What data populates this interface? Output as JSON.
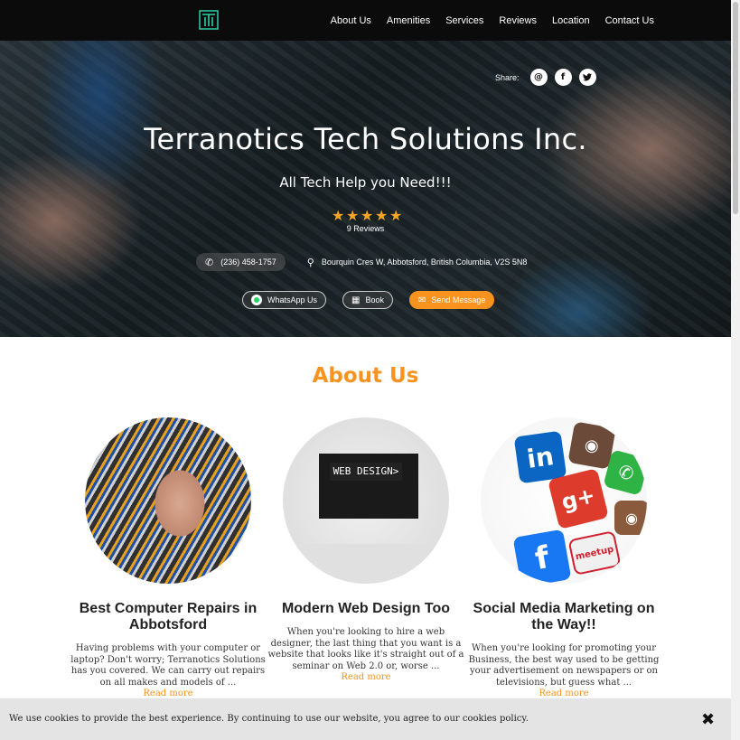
{
  "nav": {
    "items": [
      {
        "label": "About Us"
      },
      {
        "label": "Amenities"
      },
      {
        "label": "Services"
      },
      {
        "label": "Reviews"
      },
      {
        "label": "Location"
      },
      {
        "label": "Contact Us"
      }
    ]
  },
  "colors": {
    "accent": "#f7931e",
    "nav_bg": "#0b0b0b",
    "logo": "#2fd0a8"
  },
  "hero": {
    "share_label": "Share:",
    "share_icons": [
      {
        "name": "email-icon",
        "glyph": "@"
      },
      {
        "name": "facebook-icon",
        "glyph": "f"
      },
      {
        "name": "twitter-icon",
        "glyph": "t"
      }
    ],
    "title": "Terranotics Tech Solutions Inc.",
    "subtitle": "All Tech Help you Need!!!",
    "rating": 5,
    "reviews_label": "9 Reviews",
    "phone": "(236) 458-1757",
    "address": "Bourquin Cres W, Abbotsford, British Columbia, V2S 5N8",
    "buttons": {
      "whatsapp": "WhatsApp Us",
      "book": "Book",
      "message": "Send Message"
    }
  },
  "about": {
    "title": "About Us",
    "cards": [
      {
        "heading": "Best Computer Repairs in Abbotsford",
        "text": "Having problems with your computer or laptop? Don't worry; Terranotics Solutions has you covered. We can carry out repairs on all makes and models of ...",
        "more": "Read more"
      },
      {
        "heading": "Modern Web Design Too",
        "image_text": "WEB DESIGN>",
        "text": "When you're looking to hire a web designer, the last thing that you want is a website that looks like it's straight out of a seminar on Web 2.0 or, worse ...",
        "more": "Read more"
      },
      {
        "heading": "Social Media Marketing on the Way!!",
        "text": "When you're looking for promoting your Business, the best way used to be getting your advertisement on newspapers or on televisions, but guess what ...",
        "more": "Read more"
      }
    ]
  },
  "cookie": {
    "text": "We use cookies to provide the best experience. By continuing to use our website, you agree to our cookies policy.",
    "close": "✖"
  }
}
